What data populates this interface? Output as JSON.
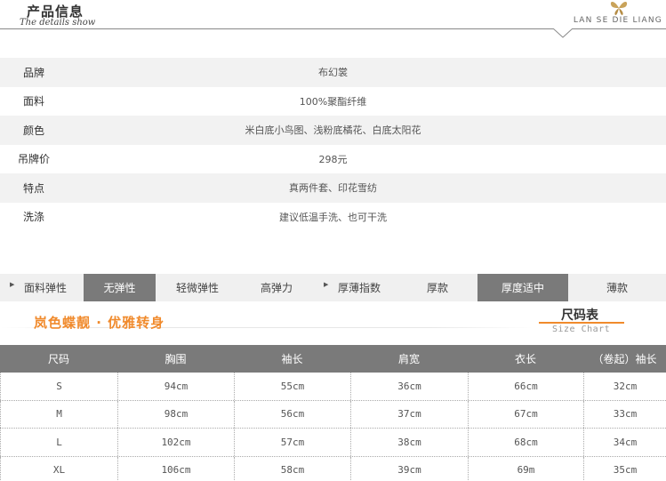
{
  "header": {
    "title": "产品信息",
    "subtitle": "The details show",
    "brand": "LAN SE DIE LIANG"
  },
  "info": {
    "rows": [
      {
        "label": "品牌",
        "value": "布幻裳"
      },
      {
        "label": "面料",
        "value": "100%聚酯纤维"
      },
      {
        "label": "颜色",
        "value": "米白底小鸟图、浅粉底橘花、白底太阳花"
      },
      {
        "label": "吊牌价",
        "value": "298元"
      },
      {
        "label": "特点",
        "value": "真两件套、印花雪纺"
      },
      {
        "label": "洗涤",
        "value": "建议低温手洗、也可干洗"
      }
    ]
  },
  "attributes": {
    "elasticity_label": "面料弹性",
    "elasticity_options": [
      "无弹性",
      "轻微弹性",
      "高弹力"
    ],
    "elasticity_selected": "无弹性",
    "thickness_label": "厚薄指数",
    "thickness_options": [
      "厚款",
      "厚度适中",
      "薄款"
    ],
    "thickness_selected": "厚度适中",
    "selected_color": "#7a7a7a"
  },
  "slogan": "岚色蝶靓 · 优雅转身",
  "size_chart": {
    "title": "尺码表",
    "subtitle": "Size Chart",
    "accent_color": "#f08a2c",
    "headers": [
      "尺码",
      "胸围",
      "袖长",
      "肩宽",
      "衣长",
      "（卷起）袖长"
    ],
    "rows": [
      [
        "S",
        "94cm",
        "55cm",
        "36cm",
        "66cm",
        "32cm"
      ],
      [
        "M",
        "98cm",
        "56cm",
        "37cm",
        "67cm",
        "33cm"
      ],
      [
        "L",
        "102cm",
        "57cm",
        "38cm",
        "68cm",
        "34cm"
      ],
      [
        "XL",
        "106cm",
        "58cm",
        "39cm",
        "69m",
        "35cm"
      ]
    ]
  }
}
